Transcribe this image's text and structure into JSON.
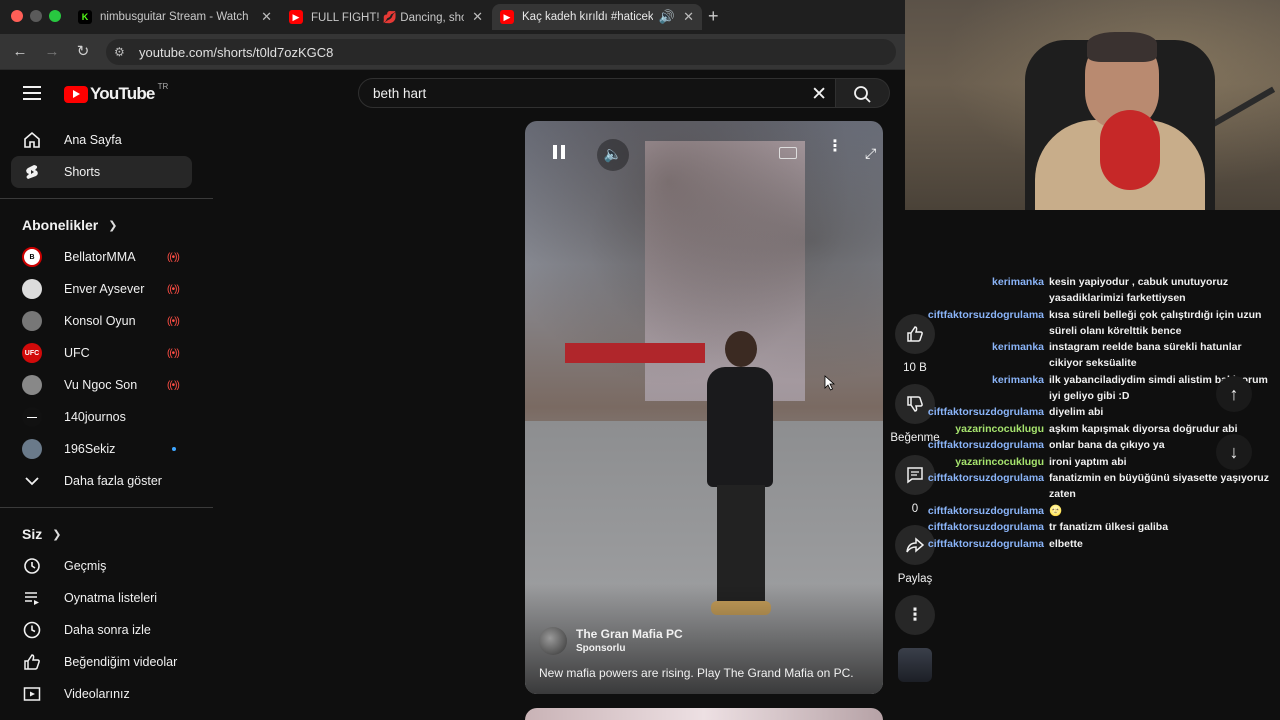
{
  "browser": {
    "tabs": [
      {
        "title": "nimbusguitar Stream - Watch",
        "fav": "K",
        "fav_color": "#53fc18",
        "active": false
      },
      {
        "title": "FULL FIGHT! 💋 Dancing, sho",
        "fav": "",
        "fav_color": "#ff0000",
        "active": false
      },
      {
        "title": "Kaç kadeh kırıldı #haticek",
        "fav": "",
        "fav_color": "#ff0000",
        "active": true
      }
    ],
    "url": "youtube.com/shorts/t0ld7ozKGC8"
  },
  "header": {
    "logo_text": "YouTube",
    "country": "TR",
    "search_value": "beth hart"
  },
  "sidebar": {
    "main": [
      {
        "label": "Ana Sayfa",
        "icon": "home-icon"
      },
      {
        "label": "Shorts",
        "icon": "shorts-icon"
      }
    ],
    "subs_title": "Abonelikler",
    "subscriptions": [
      {
        "label": "BellatorMMA",
        "live": true,
        "avatar_color": "#ffffff",
        "avatar_text": "B"
      },
      {
        "label": "Enver Aysever",
        "live": true,
        "avatar_color": "#dcdcdc",
        "avatar_text": ""
      },
      {
        "label": "Konsol Oyun",
        "live": true,
        "avatar_color": "#777777",
        "avatar_text": ""
      },
      {
        "label": "UFC",
        "live": true,
        "avatar_color": "#d20a0a",
        "avatar_text": "UFC"
      },
      {
        "label": "Vu Ngoc Son",
        "live": true,
        "avatar_color": "#888888",
        "avatar_text": ""
      },
      {
        "label": "140journos",
        "live": false,
        "avatar_color": "#111111",
        "avatar_text": "—"
      },
      {
        "label": "196Sekiz",
        "live": false,
        "new": true,
        "avatar_color": "#6a7a8a",
        "avatar_text": ""
      }
    ],
    "show_more": "Daha fazla göster",
    "you_title": "Siz",
    "you_items": [
      {
        "label": "Geçmiş",
        "icon": "history-icon"
      },
      {
        "label": "Oynatma listeleri",
        "icon": "playlists-icon"
      },
      {
        "label": "Daha sonra izle",
        "icon": "watch-later-icon"
      },
      {
        "label": "Beğendiğim videolar",
        "icon": "liked-icon"
      },
      {
        "label": "Videolarınız",
        "icon": "your-videos-icon"
      }
    ]
  },
  "short": {
    "ad_title": "The Gran Mafia PC",
    "ad_sponsored": "Sponsorlu",
    "ad_desc": "New mafia powers are rising. Play The Grand Mafia on PC."
  },
  "actions": {
    "likes": "10 B",
    "dislike": "Beğenme",
    "comments": "0",
    "share": "Paylaş"
  },
  "chat": [
    {
      "user": "kerimanka",
      "color": "#8ab4f8",
      "text": "kesin yapiyodur , cabuk unutuyoruz yasadiklarimizi farkettiysen"
    },
    {
      "user": "ciftfaktorsuzdogrulama",
      "color": "#8ab4f8",
      "text": "kısa süreli belleği çok çalıştırdığı için uzun süreli olanı körelttik bence"
    },
    {
      "user": "kerimanka",
      "color": "#8ab4f8",
      "text": "instagram reelde bana sürekli hatunlar cikiyor seksüalite"
    },
    {
      "user": "kerimanka",
      "color": "#8ab4f8",
      "text": "ilk yabanciladiydim simdi alistim bakiyorum iyi geliyo gibi :D"
    },
    {
      "user": "ciftfaktorsuzdogrulama",
      "color": "#8ab4f8",
      "text": "diyelim abi"
    },
    {
      "user": "yazarincocuklugu",
      "color": "#a6e36e",
      "text": "aşkım kapışmak diyorsa doğrudur abi"
    },
    {
      "user": "ciftfaktorsuzdogrulama",
      "color": "#8ab4f8",
      "text": "onlar bana da çıkıyo ya"
    },
    {
      "user": "yazarincocuklugu",
      "color": "#a6e36e",
      "text": "ironi yaptım abi"
    },
    {
      "user": "ciftfaktorsuzdogrulama",
      "color": "#8ab4f8",
      "text": "fanatizmin en büyüğünü siyasette yaşıyoruz zaten"
    },
    {
      "user": "ciftfaktorsuzdogrulama",
      "color": "#8ab4f8",
      "text": "🌝"
    },
    {
      "user": "ciftfaktorsuzdogrulama",
      "color": "#8ab4f8",
      "text": "tr fanatizm ülkesi galiba"
    },
    {
      "user": "ciftfaktorsuzdogrulama",
      "color": "#8ab4f8",
      "text": "elbette"
    }
  ]
}
